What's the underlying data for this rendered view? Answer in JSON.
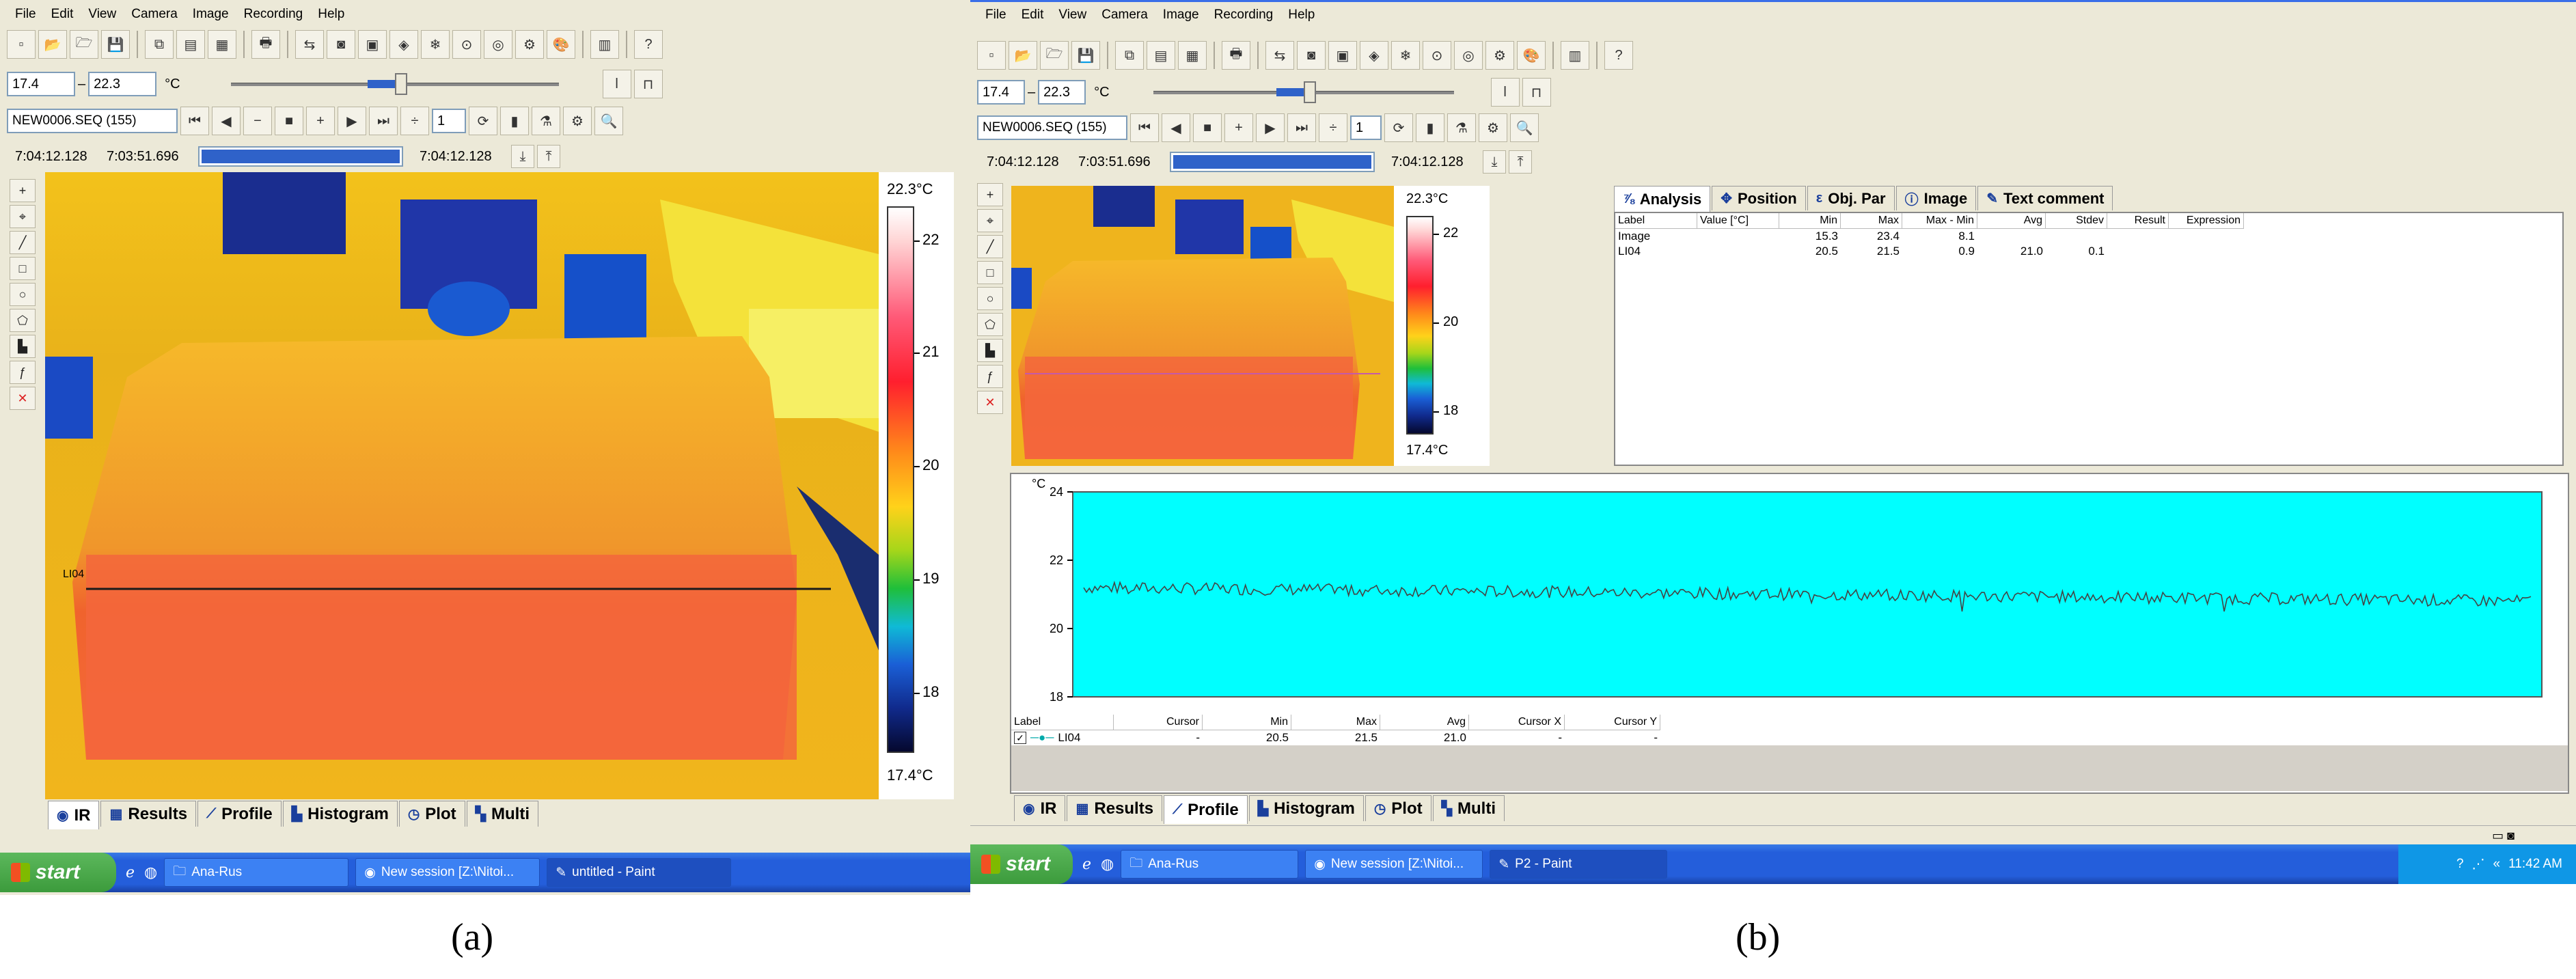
{
  "menus": [
    "File",
    "Edit",
    "View",
    "Camera",
    "Image",
    "Recording",
    "Help"
  ],
  "temp_range": {
    "min": "17.4",
    "sep": "–",
    "max": "22.3",
    "unit": "°C"
  },
  "sequence": {
    "file": "NEW0006.SEQ (155)",
    "step": "1"
  },
  "times": {
    "start": "7:04:12.128",
    "current": "7:03:51.696",
    "end": "7:04:12.128",
    "progress": 1.0
  },
  "colorbar": {
    "top_label": "22.3°C",
    "bottom_label": "17.4°C",
    "ticks_a": [
      "22",
      "21",
      "20",
      "19",
      "18"
    ],
    "ticks_b": [
      "22",
      "20",
      "18"
    ]
  },
  "line_label": "LI04",
  "tabs_a": [
    "IR",
    "Results",
    "Profile",
    "Histogram",
    "Plot",
    "Multi"
  ],
  "tabs_b": [
    "IR",
    "Results",
    "Profile",
    "Histogram",
    "Plot",
    "Multi"
  ],
  "analysis_tabs": [
    "Analysis",
    "Position",
    "Obj. Par",
    "Image",
    "Text comment"
  ],
  "analysis_table": {
    "headers": [
      "Label",
      "Value [°C]",
      "Min",
      "Max",
      "Max - Min",
      "Avg",
      "Stdev",
      "Result",
      "Expression"
    ],
    "rows": [
      [
        "Image",
        "",
        "15.3",
        "23.4",
        "8.1",
        "",
        "",
        "",
        ""
      ],
      [
        "LI04",
        "",
        "20.5",
        "21.5",
        "0.9",
        "21.0",
        "0.1",
        "",
        ""
      ]
    ]
  },
  "profile_table": {
    "headers": [
      "Label",
      "Cursor",
      "Min",
      "Max",
      "Avg",
      "Cursor X",
      "Cursor Y"
    ],
    "rows": [
      [
        "LI04",
        "-",
        "20.5",
        "21.5",
        "21.0",
        "-",
        "-"
      ]
    ]
  },
  "chart_data": {
    "type": "line",
    "title": "",
    "xlabel": "",
    "ylabel": "°C",
    "ylim": [
      18,
      24
    ],
    "yticks": [
      "24",
      "22",
      "20",
      "18"
    ],
    "grid": false,
    "background": "#00ffff",
    "series": [
      {
        "name": "LI04",
        "mean": 21.0,
        "min": 20.5,
        "max": 21.5,
        "trend": "slight decrease from ~21.2 to ~20.8 with ±0.2 noise"
      }
    ]
  },
  "taskbar_a": {
    "start": "start",
    "tasks": [
      "Ana-Rus",
      "New session [Z:\\Nitoi...",
      "untitled - Paint"
    ]
  },
  "taskbar_b": {
    "start": "start",
    "tasks": [
      "Ana-Rus",
      "New session [Z:\\Nitoi...",
      "P2 - Paint"
    ],
    "clock": "11:42 AM"
  },
  "captions": {
    "a": "(a)",
    "b": "(b)"
  }
}
